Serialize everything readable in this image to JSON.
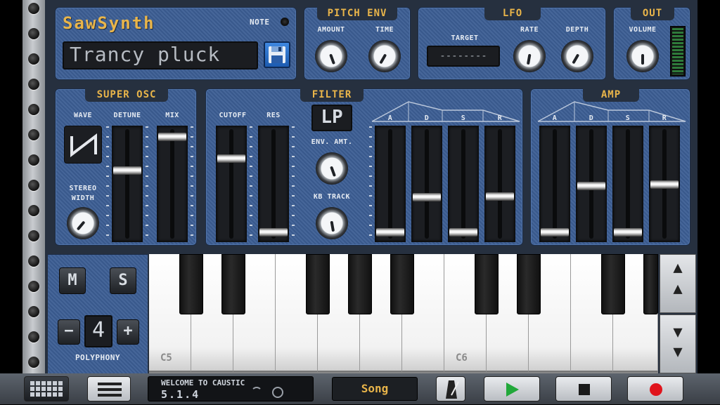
{
  "title": "SawSynth",
  "note_label": "NOTE",
  "preset_name": "Trancy pluck",
  "pitch_env": {
    "title": "PITCH ENV",
    "amount_label": "AMOUNT",
    "time_label": "TIME"
  },
  "lfo": {
    "title": "LFO",
    "target_label": "TARGET",
    "target_value": "--------",
    "rate_label": "RATE",
    "depth_label": "DEPTH"
  },
  "out": {
    "title": "OUT",
    "volume_label": "VOLUME"
  },
  "super_osc": {
    "title": "SUPER OSC",
    "wave_label": "WAVE",
    "detune_label": "DETUNE",
    "mix_label": "MIX",
    "stereo_label": "STEREO",
    "width_label": "WIDTH"
  },
  "filter": {
    "title": "FILTER",
    "cutoff_label": "CUTOFF",
    "res_label": "RES",
    "mode_value": "LP",
    "env_amt_label": "ENV. AMT.",
    "kb_track_label": "KB TRACK",
    "adsr": [
      "A",
      "D",
      "S",
      "R"
    ]
  },
  "amp": {
    "title": "AMP",
    "adsr": [
      "A",
      "D",
      "S",
      "R"
    ]
  },
  "levels": {
    "detune": 0.63,
    "mix": 0.96,
    "cutoff": 0.75,
    "res": 0.03,
    "filter_a": 0.03,
    "filter_d": 0.37,
    "filter_s": 0.03,
    "filter_r": 0.38,
    "amp_a": 0.03,
    "amp_d": 0.48,
    "amp_s": 0.03,
    "amp_r": 0.49
  },
  "keyboard": {
    "mute_label": "M",
    "solo_label": "S",
    "minus_label": "−",
    "plus_label": "+",
    "polyphony_value": "4",
    "polyphony_label": "POLYPHONY",
    "c5_label": "C5",
    "c6_label": "C6",
    "octave_up": "▲",
    "octave_down": "▼"
  },
  "transport": {
    "status_line1": "WELCOME TO CAUSTIC",
    "status_line2": "5.1.4",
    "song_label": "Song"
  },
  "colors": {
    "accent": "#e9b54a",
    "panel": "#3c5e94",
    "play": "#22a83a",
    "record": "#e0141c"
  }
}
